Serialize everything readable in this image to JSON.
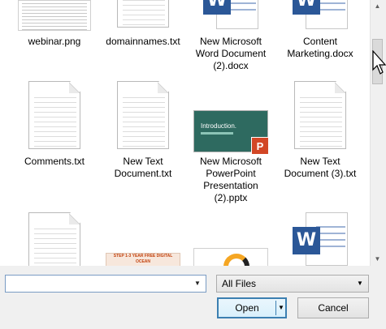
{
  "files": [
    {
      "name": "webinar.png"
    },
    {
      "name": "domainnames.txt"
    },
    {
      "name": "New Microsoft Word Document (2).docx",
      "lines": [
        "New Microsoft",
        "Word Document",
        "(2).docx"
      ]
    },
    {
      "name": "Content Marketing.docx",
      "lines": [
        "Content",
        "Marketing.docx"
      ]
    },
    {
      "name": "Comments.txt"
    },
    {
      "name": "New Text Document.txt",
      "lines": [
        "New Text",
        "Document.txt"
      ]
    },
    {
      "name": "New Microsoft PowerPoint Presentation (2).pptx",
      "lines": [
        "New Microsoft",
        "PowerPoint",
        "Presentation",
        "(2).pptx"
      ]
    },
    {
      "name": "New Text Document (3).txt",
      "lines": [
        "New Text",
        "Document (3).txt"
      ]
    }
  ],
  "ppt_thumb_title": "Introduction.",
  "word_badge": "W",
  "ppt_badge": "P",
  "partial_image_text": "STEP 1-3 YEAR FREE DIGITAL OCEAN",
  "colors": {
    "word": "#2b5797",
    "ppt_bg": "#2e6a60",
    "ppt_badge": "#d24726",
    "accent_border": "#3c7fb1"
  },
  "dialog": {
    "filename_value": "",
    "filetype_selected": "All Files",
    "open_label": "Open",
    "cancel_label": "Cancel"
  }
}
